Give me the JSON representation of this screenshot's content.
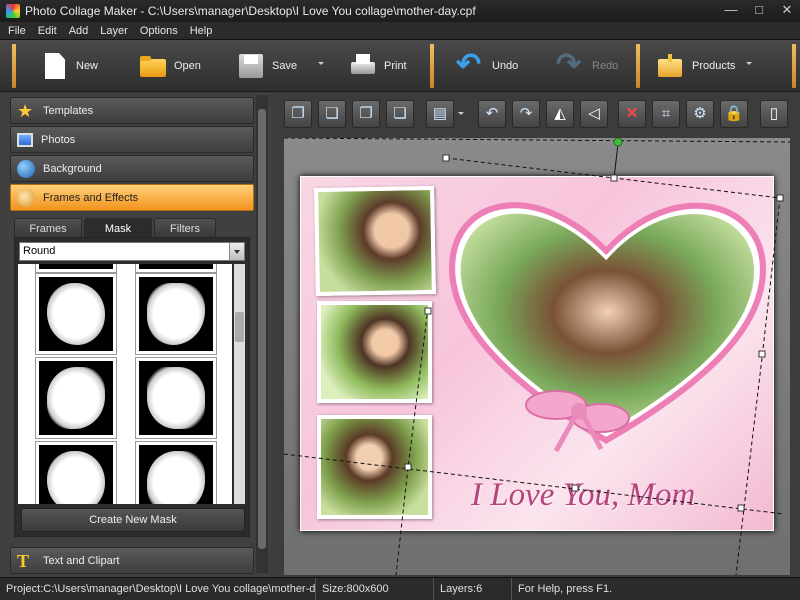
{
  "window": {
    "title": "Photo Collage Maker - C:\\Users\\manager\\Desktop\\I Love You collage\\mother-day.cpf",
    "minimize": "—",
    "maximize": "□",
    "close": "✕"
  },
  "menu": [
    "File",
    "Edit",
    "Add",
    "Layer",
    "Options",
    "Help"
  ],
  "toolbar": {
    "new_label": "New",
    "open_label": "Open",
    "save_label": "Save",
    "print_label": "Print",
    "undo_label": "Undo",
    "redo_label": "Redo",
    "products_label": "Products"
  },
  "sidebar": {
    "sections": [
      {
        "label": "Templates",
        "icon": "star-icon"
      },
      {
        "label": "Photos",
        "icon": "photo-icon"
      },
      {
        "label": "Background",
        "icon": "background-icon"
      },
      {
        "label": "Frames and Effects",
        "icon": "palette-icon"
      }
    ],
    "bottom_section": {
      "label": "Text and Clipart",
      "icon": "text-icon"
    },
    "tabs": [
      "Frames",
      "Mask",
      "Filters"
    ],
    "active_tab": "Mask",
    "mask_type": "Round",
    "create_mask_label": "Create New Mask"
  },
  "canvas_toolbar": {
    "icons": [
      "bring-to-front-icon",
      "send-to-back-icon",
      "bring-forward-icon",
      "send-backward-icon",
      "align-icon",
      "rotate-left-icon",
      "rotate-right-icon",
      "flip-horizontal-icon",
      "flip-vertical-icon",
      "delete-icon",
      "crop-icon",
      "settings-icon",
      "lock-icon",
      "page-icon"
    ]
  },
  "collage": {
    "caption": "I Love You, Mom"
  },
  "status": {
    "project": "Project:C:\\Users\\manager\\Desktop\\I Love You collage\\mother-da...",
    "size": "Size:800x600",
    "layers": "Layers:6",
    "help": "For Help, press F1."
  },
  "colors": {
    "accent": "#f2941d",
    "heart": "#ee7fb6",
    "caption": "#b5447e"
  }
}
